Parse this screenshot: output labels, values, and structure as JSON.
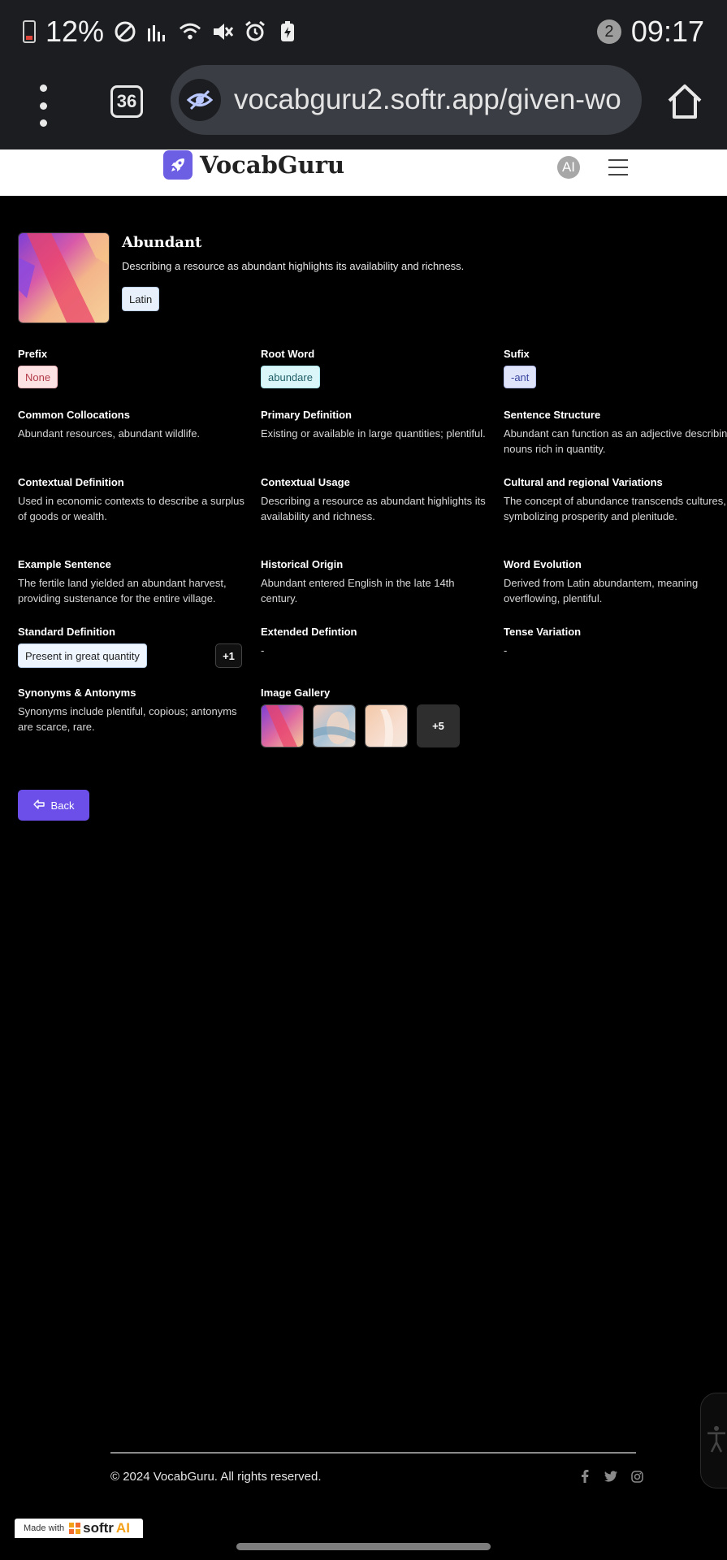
{
  "status_bar": {
    "battery": "12%",
    "notification_count": "2",
    "time": "09:17"
  },
  "browser": {
    "tab_count": "36",
    "url": "vocabguru2.softr.app/given-wo"
  },
  "site": {
    "brand": "VocabGuru",
    "avatar_initials": "AI",
    "accent": "#6b4fe8"
  },
  "word": {
    "title": "Abundant",
    "description": "Describing a resource as abundant highlights its availability and richness.",
    "origin_tag": "Latin"
  },
  "fields": {
    "prefix": {
      "label": "Prefix",
      "value": "None"
    },
    "root": {
      "label": "Root Word",
      "value": "abundare"
    },
    "suffix": {
      "label": "Sufix",
      "value": "-ant"
    },
    "collocations": {
      "label": "Common Collocations",
      "value": "Abundant resources, abundant wildlife."
    },
    "primary_def": {
      "label": "Primary Definition",
      "value": "Existing or available in large quantities; plentiful."
    },
    "sentence_structure": {
      "label": "Sentence Structure",
      "value": "Abundant can function as an adjective describing nouns rich in quantity."
    },
    "contextual_def": {
      "label": "Contextual Definition",
      "value": "Used in economic contexts to describe a surplus of goods or wealth."
    },
    "contextual_usage": {
      "label": "Contextual Usage",
      "value": "Describing a resource as abundant highlights its availability and richness."
    },
    "cultural": {
      "label": "Cultural and regional Variations",
      "value": "The concept of abundance transcends cultures, symbolizing prosperity and plenitude."
    },
    "example": {
      "label": "Example Sentence",
      "value": "The fertile land yielded an abundant harvest, providing sustenance for the entire village."
    },
    "history": {
      "label": "Historical Origin",
      "value": "Abundant entered English in the late 14th century."
    },
    "evolution": {
      "label": "Word Evolution",
      "value": "Derived from Latin abundantem, meaning overflowing, plentiful."
    },
    "standard_def": {
      "label": "Standard Definition",
      "value": "Present in great quantity",
      "more": "+1"
    },
    "extended_def": {
      "label": "Extended Defintion",
      "value": "-"
    },
    "tense": {
      "label": "Tense Variation",
      "value": "-"
    },
    "synonyms": {
      "label": "Synonyms & Antonyms",
      "value": "Synonyms include plentiful, copious; antonyms are scarce, rare."
    },
    "gallery": {
      "label": "Image Gallery",
      "more": "+5"
    }
  },
  "actions": {
    "back_label": "Back"
  },
  "footer": {
    "copyright": "© 2024 VocabGuru. All rights reserved.",
    "made_with": "Made with",
    "made_brand_a": "softr",
    "made_brand_b": "AI"
  }
}
